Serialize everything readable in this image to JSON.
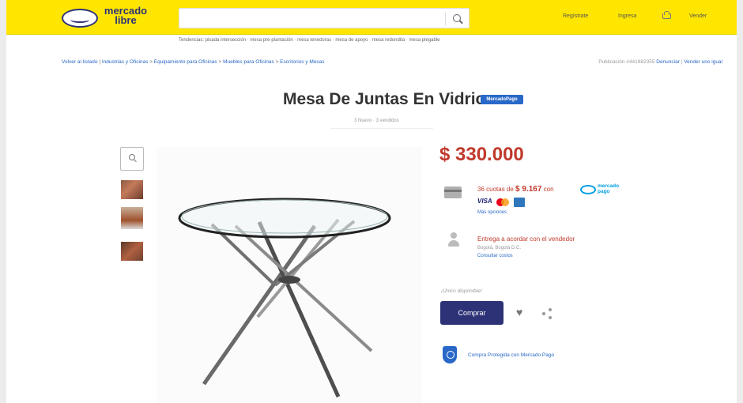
{
  "header": {
    "logo_text": "mercado libre",
    "search_value": "",
    "nav": [
      "Regístrate",
      "Ingresa",
      "Vender"
    ],
    "search_suggestions": "Tendencias: pisada intersección · mesa pre-plantación · mesa tenedoras · mesa de apoyo · mesa redondita · mesa plegable"
  },
  "breadcrumb": {
    "back": "Volver al listado",
    "path": [
      "Industrias y Oficinas",
      "Equipamiento para Oficinas",
      "Muebles para Oficinas",
      "Escritorios y Mesas"
    ]
  },
  "publication": {
    "number": "Publicación #441982355",
    "denounce": "Denunciar",
    "sell_similar": "Vender uno igual"
  },
  "product": {
    "title": "Mesa De Juntas En Vidrio",
    "badge": "MercadoPago",
    "sold_info": "3 Nuevo · 3 vendidos",
    "price": "$ 330.000"
  },
  "payment": {
    "cuotas_prefix": "36 cuotas de",
    "cuota_value": "$ 9.167",
    "cuotas_suffix": "con",
    "mercadopago_label": "mercado pago",
    "visa": "VISA",
    "more_methods": "Más opciones"
  },
  "shipping": {
    "title": "Entrega a acordar con el vendedor",
    "location": "Bogotá, Bogotá D.C.",
    "consult": "Consultar costos"
  },
  "purchase": {
    "unique_available": "¡Único disponible!",
    "buy_label": "Comprar",
    "protection": "Compra Protegida con Mercado Pago"
  }
}
